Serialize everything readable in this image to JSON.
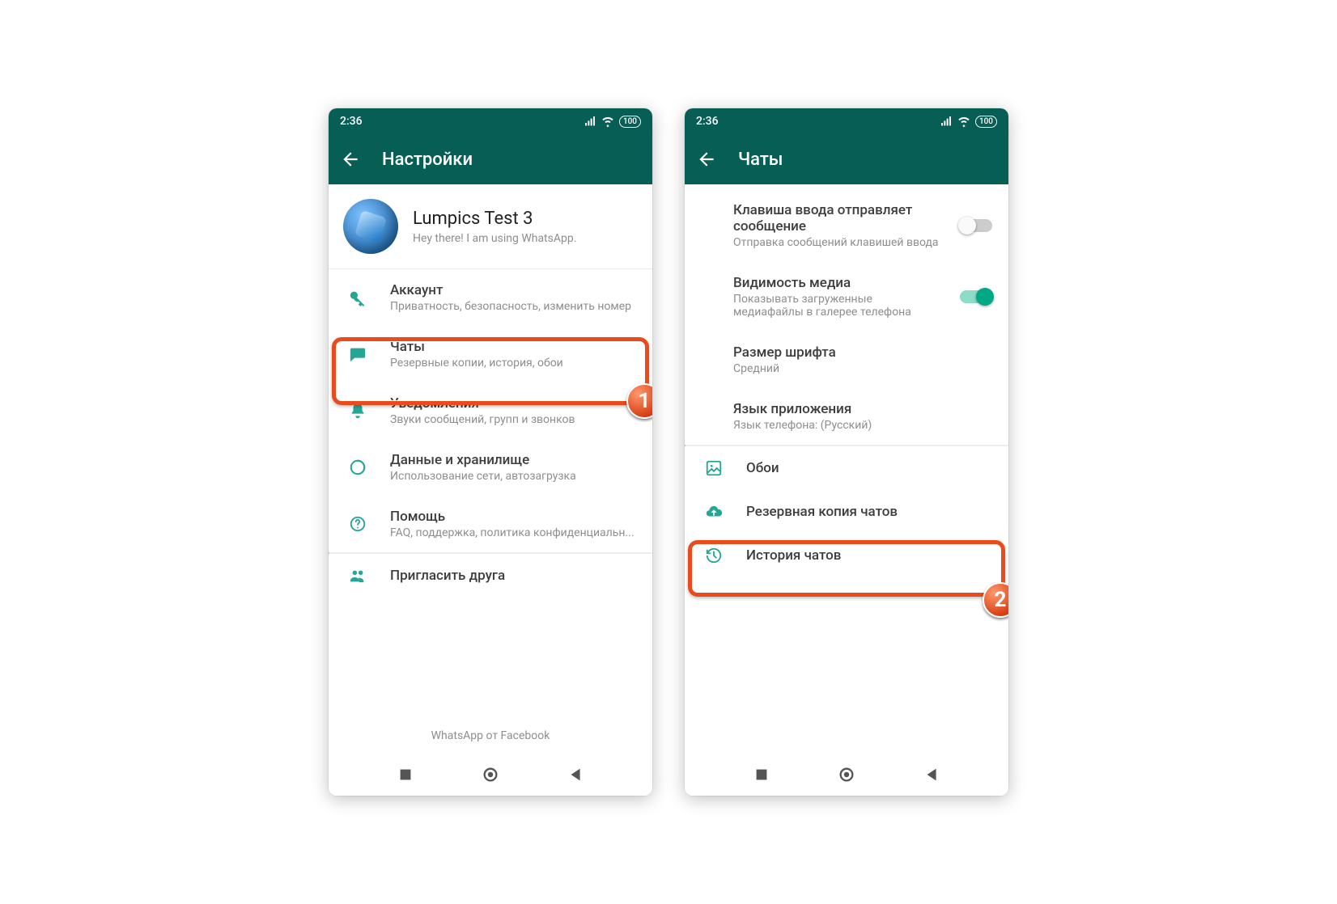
{
  "statusbar": {
    "time": "2:36",
    "battery": "100"
  },
  "left": {
    "title": "Настройки",
    "profile": {
      "name": "Lumpics Test 3",
      "status": "Hey there! I am using WhatsApp."
    },
    "rows": [
      {
        "icon": "key",
        "label": "Аккаунт",
        "sub": "Приватность, безопасность, изменить номер"
      },
      {
        "icon": "chat",
        "label": "Чаты",
        "sub": "Резервные копии, история, обои"
      },
      {
        "icon": "bell",
        "label": "Уведомления",
        "sub": "Звуки сообщений, групп и звонков"
      },
      {
        "icon": "data",
        "label": "Данные и хранилище",
        "sub": "Использование сети, автозагрузка"
      },
      {
        "icon": "help",
        "label": "Помощь",
        "sub": "FAQ, поддержка, политика конфиденциальн..."
      },
      {
        "icon": "invite",
        "label": "Пригласить друга",
        "sub": ""
      }
    ],
    "footer": "WhatsApp от Facebook",
    "highlight_badge": "1"
  },
  "right": {
    "title": "Чаты",
    "groups": {
      "enter": {
        "label": "Клавиша ввода отправляет сообщение",
        "sub": "Отправка сообщений клавишей ввода",
        "on": false
      },
      "media": {
        "label": "Видимость медиа",
        "sub": "Показывать загруженные медиафайлы в галерее телефона",
        "on": true
      },
      "font": {
        "label": "Размер шрифта",
        "sub": "Средний"
      },
      "lang": {
        "label": "Язык приложения",
        "sub": "Язык телефона: (Русский)"
      },
      "wallpaper": {
        "label": "Обои"
      },
      "backup": {
        "label": "Резервная копия чатов"
      },
      "history": {
        "label": "История чатов"
      }
    },
    "highlight_badge": "2"
  }
}
